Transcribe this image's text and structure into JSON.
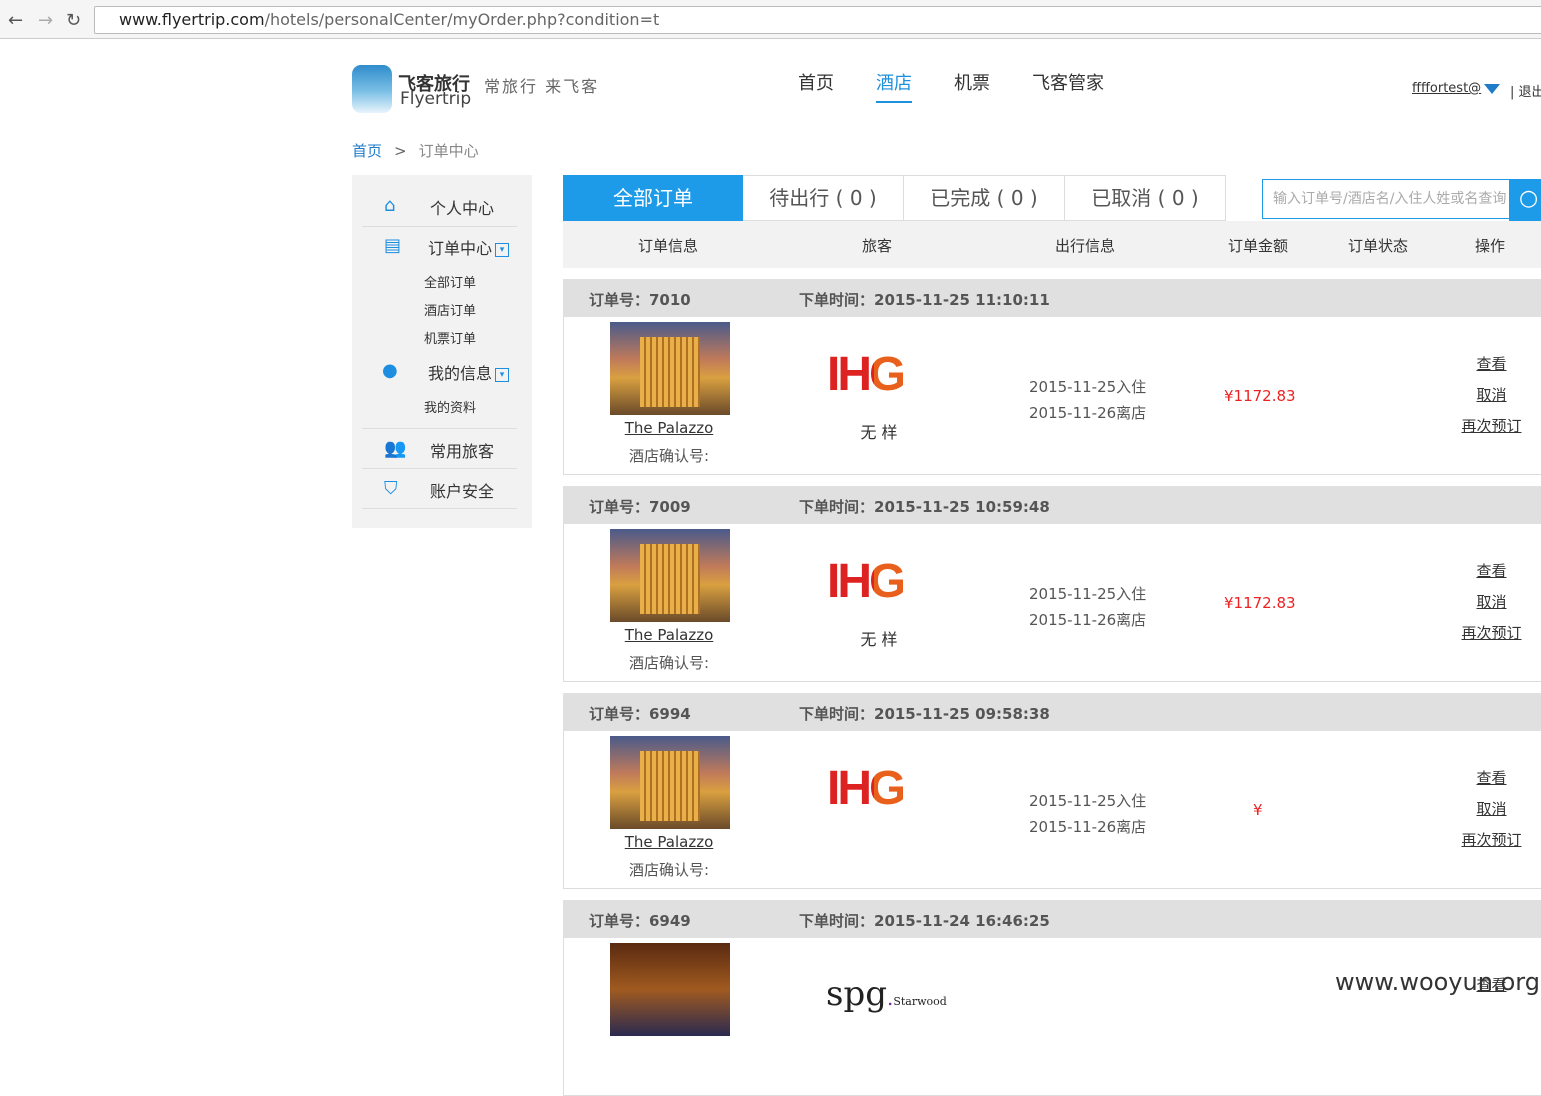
{
  "browser": {
    "url_domain": "www.flyertrip.com",
    "url_path": "/hotels/personalCenter/myOrder.php?condition=t"
  },
  "header": {
    "logo_cn": "飞客旅行",
    "logo_en": "Flyertrip",
    "slogan": "常旅行  来飞客",
    "nav": [
      {
        "label": "首页"
      },
      {
        "label": "酒店",
        "active": true
      },
      {
        "label": "机票"
      },
      {
        "label": "飞客管家"
      }
    ],
    "user": "ffffortest@",
    "logout": "退出"
  },
  "breadcrumb": {
    "home": "首页",
    "sep": ">",
    "current": "订单中心"
  },
  "sidebar": {
    "personal": "个人中心",
    "orders": "订单中心",
    "order_subs": [
      "全部订单",
      "酒店订单",
      "机票订单"
    ],
    "myinfo": "我的信息",
    "myinfo_subs": [
      "我的资料"
    ],
    "travelers": "常用旅客",
    "security": "账户安全"
  },
  "tabs": [
    "全部订单",
    "待出行 ( 0 )",
    "已完成 ( 0 )",
    "已取消 ( 0 )"
  ],
  "search": {
    "placeholder": "输入订单号/酒店名/入住人姓或名查询"
  },
  "columns": [
    "订单信息",
    "旅客",
    "出行信息",
    "订单金额",
    "订单状态",
    "操作"
  ],
  "orders": [
    {
      "no_label": "订单号：7010",
      "time_label": "下单时间：2015-11-25 11:10:11",
      "hotel": "The Palazzo",
      "conf": "酒店确认号:",
      "brand": "IHG",
      "guest": "无 样",
      "checkin": "2015-11-25入住",
      "checkout": "2015-11-26离店",
      "amount": "¥1172.83",
      "ops": [
        "查看",
        "取消",
        "再次预订"
      ]
    },
    {
      "no_label": "订单号：7009",
      "time_label": "下单时间：2015-11-25 10:59:48",
      "hotel": "The Palazzo",
      "conf": "酒店确认号:",
      "brand": "IHG",
      "guest": "无 样",
      "checkin": "2015-11-25入住",
      "checkout": "2015-11-26离店",
      "amount": "¥1172.83",
      "ops": [
        "查看",
        "取消",
        "再次预订"
      ]
    },
    {
      "no_label": "订单号：6994",
      "time_label": "下单时间：2015-11-25 09:58:38",
      "hotel": "The Palazzo",
      "conf": "酒店确认号:",
      "brand": "IHG",
      "guest": "",
      "checkin": "2015-11-25入住",
      "checkout": "2015-11-26离店",
      "amount": "¥",
      "ops": [
        "查看",
        "取消",
        "再次预订"
      ]
    },
    {
      "no_label": "订单号：6949",
      "time_label": "下单时间：2015-11-24 16:46:25",
      "brand": "spg",
      "brand_sub": "Starwood",
      "ops": [
        "查看"
      ]
    }
  ],
  "watermark": "www.wooyun.org"
}
